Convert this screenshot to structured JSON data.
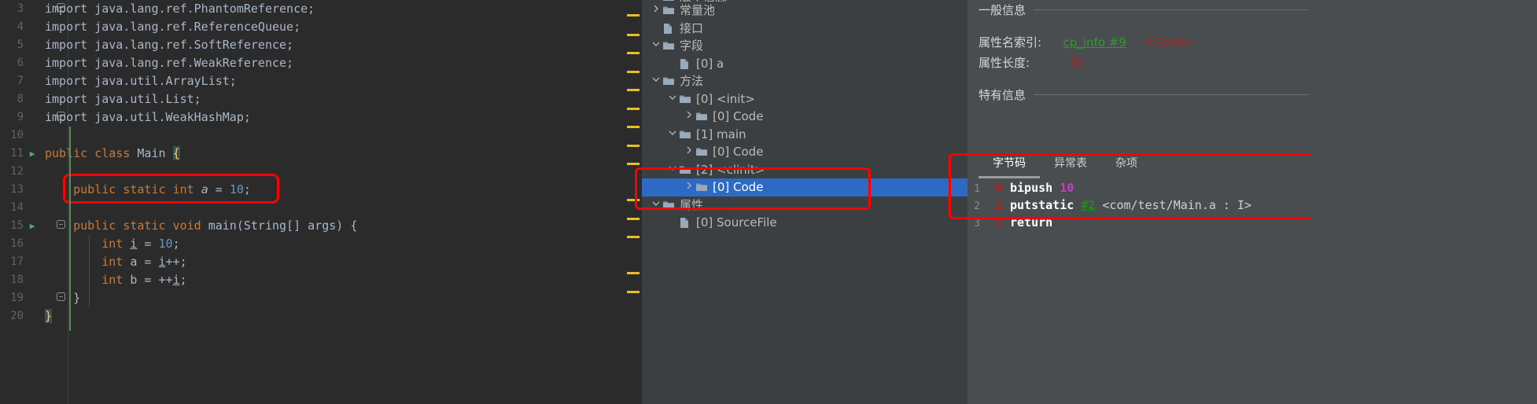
{
  "editor": {
    "lines": [
      {
        "num": "3",
        "run": false,
        "fold": "minus-top",
        "indent": 0,
        "tokens": [
          {
            "t": "import java.lang.ref.PhantomReference;",
            "c": "white"
          }
        ]
      },
      {
        "num": "4",
        "run": false,
        "fold": "",
        "indent": 0,
        "tokens": [
          {
            "t": "import java.lang.ref.ReferenceQueue;",
            "c": "white"
          }
        ]
      },
      {
        "num": "5",
        "run": false,
        "fold": "",
        "indent": 0,
        "tokens": [
          {
            "t": "import java.lang.ref.SoftReference;",
            "c": "white"
          }
        ]
      },
      {
        "num": "6",
        "run": false,
        "fold": "",
        "indent": 0,
        "tokens": [
          {
            "t": "import java.lang.ref.WeakReference;",
            "c": "white"
          }
        ]
      },
      {
        "num": "7",
        "run": false,
        "fold": "",
        "indent": 0,
        "tokens": [
          {
            "t": "import java.util.ArrayList;",
            "c": "white"
          }
        ]
      },
      {
        "num": "8",
        "run": false,
        "fold": "",
        "indent": 0,
        "tokens": [
          {
            "t": "import java.util.List;",
            "c": "white"
          }
        ]
      },
      {
        "num": "9",
        "run": false,
        "fold": "minus-bottom",
        "indent": 0,
        "tokens": [
          {
            "t": "import java.util.WeakHashMap;",
            "c": "white"
          }
        ]
      },
      {
        "num": "10",
        "run": false,
        "fold": "",
        "indent": 0,
        "tokens": []
      },
      {
        "num": "11",
        "run": true,
        "fold": "",
        "indent": 0,
        "tokens": [
          {
            "t": "public",
            "c": "kw"
          },
          {
            "t": " ",
            "c": "white"
          },
          {
            "t": "class",
            "c": "kw"
          },
          {
            "t": " ",
            "c": "white"
          },
          {
            "t": "Main",
            "c": "cls"
          },
          {
            "t": " ",
            "c": "white"
          },
          {
            "t": "{",
            "c": "brace-hl"
          }
        ]
      },
      {
        "num": "12",
        "run": false,
        "fold": "",
        "indent": 0,
        "tokens": []
      },
      {
        "num": "13",
        "run": false,
        "fold": "",
        "indent": 0,
        "tokens": [
          {
            "t": "    ",
            "c": "white"
          },
          {
            "t": "public",
            "c": "kw"
          },
          {
            "t": " ",
            "c": "white"
          },
          {
            "t": "static",
            "c": "kw"
          },
          {
            "t": " ",
            "c": "white"
          },
          {
            "t": "int",
            "c": "kw"
          },
          {
            "t": " ",
            "c": "white"
          },
          {
            "t": "a",
            "c": "fld"
          },
          {
            "t": " = ",
            "c": "white"
          },
          {
            "t": "10",
            "c": "num"
          },
          {
            "t": ";",
            "c": "white"
          }
        ]
      },
      {
        "num": "14",
        "run": false,
        "fold": "",
        "indent": 0,
        "tokens": []
      },
      {
        "num": "15",
        "run": true,
        "fold": "minus-top",
        "indent": 0,
        "tokens": [
          {
            "t": "    ",
            "c": "white"
          },
          {
            "t": "public",
            "c": "kw"
          },
          {
            "t": " ",
            "c": "white"
          },
          {
            "t": "static",
            "c": "kw"
          },
          {
            "t": " ",
            "c": "white"
          },
          {
            "t": "void",
            "c": "kw"
          },
          {
            "t": " ",
            "c": "white"
          },
          {
            "t": "main",
            "c": "cls"
          },
          {
            "t": "(",
            "c": "white"
          },
          {
            "t": "String",
            "c": "cls"
          },
          {
            "t": "[] args) {",
            "c": "white"
          }
        ]
      },
      {
        "num": "16",
        "run": false,
        "fold": "",
        "indent": 1,
        "tokens": [
          {
            "t": "        ",
            "c": "white"
          },
          {
            "t": "int",
            "c": "kw"
          },
          {
            "t": " ",
            "c": "white"
          },
          {
            "t": "i",
            "c": "varu"
          },
          {
            "t": " = ",
            "c": "white"
          },
          {
            "t": "10",
            "c": "num"
          },
          {
            "t": ";",
            "c": "white"
          }
        ]
      },
      {
        "num": "17",
        "run": false,
        "fold": "",
        "indent": 1,
        "tokens": [
          {
            "t": "        ",
            "c": "white"
          },
          {
            "t": "int",
            "c": "kw"
          },
          {
            "t": " ",
            "c": "white"
          },
          {
            "t": "a",
            "c": "var"
          },
          {
            "t": " = ",
            "c": "white"
          },
          {
            "t": "i",
            "c": "varu"
          },
          {
            "t": "++;",
            "c": "white"
          }
        ]
      },
      {
        "num": "18",
        "run": false,
        "fold": "",
        "indent": 1,
        "tokens": [
          {
            "t": "        ",
            "c": "white"
          },
          {
            "t": "int",
            "c": "kw"
          },
          {
            "t": " ",
            "c": "white"
          },
          {
            "t": "b",
            "c": "var"
          },
          {
            "t": " = ++",
            "c": "white"
          },
          {
            "t": "i",
            "c": "varu"
          },
          {
            "t": ";",
            "c": "white"
          }
        ]
      },
      {
        "num": "19",
        "run": false,
        "fold": "minus-bottom",
        "indent": 1,
        "tokens": [
          {
            "t": "    }",
            "c": "white"
          }
        ]
      },
      {
        "num": "20",
        "run": false,
        "fold": "",
        "indent": 0,
        "tokens": [
          {
            "t": "}",
            "c": "brace-hl"
          }
        ]
      }
    ],
    "highlight_note": "red-box-line-13"
  },
  "stripe": {
    "marker_color": "#e8bf26",
    "marker_tops": [
      18,
      43,
      66,
      90,
      113,
      137,
      160,
      184,
      207,
      253,
      277,
      300,
      346,
      370
    ]
  },
  "tree": {
    "items": [
      {
        "indent": 0,
        "twist": "",
        "icon": "folder",
        "label": "版本信息",
        "selected": false,
        "partial": true
      },
      {
        "indent": 0,
        "twist": "▶",
        "icon": "folder",
        "label": "常量池",
        "selected": false
      },
      {
        "indent": 0,
        "twist": "",
        "icon": "file",
        "label": "接口",
        "selected": false
      },
      {
        "indent": 0,
        "twist": "▼",
        "icon": "folder",
        "label": "字段",
        "selected": false
      },
      {
        "indent": 1,
        "twist": "",
        "icon": "file",
        "label": "[0] a",
        "selected": false
      },
      {
        "indent": 0,
        "twist": "▼",
        "icon": "folder",
        "label": "方法",
        "selected": false
      },
      {
        "indent": 1,
        "twist": "▼",
        "icon": "folder",
        "label": "[0] <init>",
        "selected": false
      },
      {
        "indent": 2,
        "twist": "▶",
        "icon": "folder",
        "label": "[0] Code",
        "selected": false
      },
      {
        "indent": 1,
        "twist": "▼",
        "icon": "folder",
        "label": "[1] main",
        "selected": false
      },
      {
        "indent": 2,
        "twist": "▶",
        "icon": "folder",
        "label": "[0] Code",
        "selected": false
      },
      {
        "indent": 1,
        "twist": "▼",
        "icon": "folder",
        "label": "[2] <clinit>",
        "selected": false
      },
      {
        "indent": 2,
        "twist": "▶",
        "icon": "folder",
        "label": "[0] Code",
        "selected": true
      },
      {
        "indent": 0,
        "twist": "▼",
        "icon": "folder",
        "label": "属性",
        "selected": false
      },
      {
        "indent": 1,
        "twist": "",
        "icon": "file",
        "label": "[0] SourceFile",
        "selected": false
      }
    ]
  },
  "detail": {
    "general_section_title": "一般信息",
    "fields": [
      {
        "label": "属性名索引:",
        "link": "cp_info #9",
        "extra": "<Code>"
      },
      {
        "label": "属性长度:",
        "value": "30"
      }
    ],
    "specific_section_title": "特有信息",
    "tabs": [
      {
        "label": "字节码",
        "active": true
      },
      {
        "label": "异常表",
        "active": false
      },
      {
        "label": "杂项",
        "active": false
      }
    ],
    "bytecode": [
      {
        "line": "1",
        "offset": "0",
        "op": "bipush",
        "int": "10",
        "ref": "",
        "desc": ""
      },
      {
        "line": "2",
        "offset": "2",
        "op": "putstatic",
        "int": "",
        "ref": "#2",
        "desc": "<com/test/Main.a : I>"
      },
      {
        "line": "3",
        "offset": "5",
        "op": "return",
        "int": "",
        "ref": "",
        "desc": ""
      }
    ]
  },
  "colors": {
    "editor_bg": "#2b2b2b",
    "tree_bg": "#3c3f41",
    "detail_bg": "#4a4d4f",
    "selection_blue": "#2d6ac4",
    "annotation_red": "#ff0000",
    "keyword_orange": "#cc7832",
    "number_blue": "#6897bb",
    "marker_yellow": "#e8bf26",
    "link_green": "#2e9b2e",
    "value_red": "#b32020"
  }
}
